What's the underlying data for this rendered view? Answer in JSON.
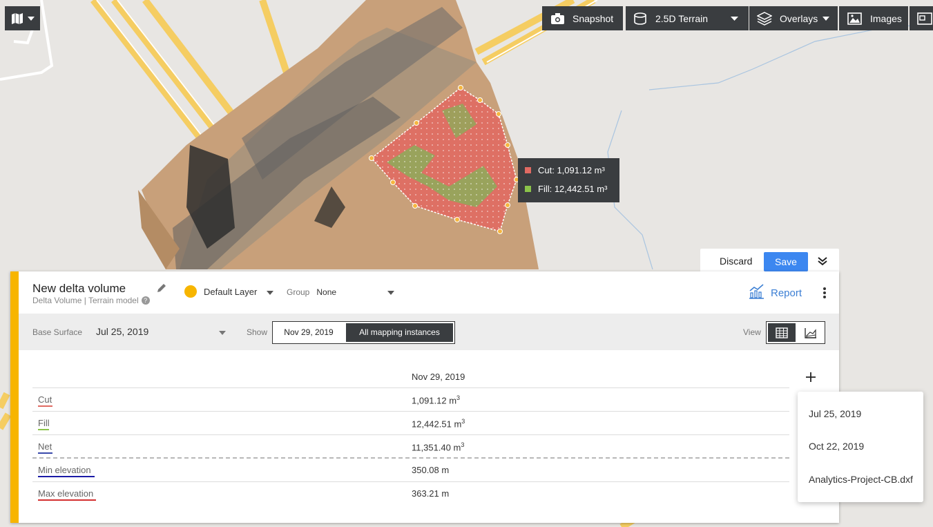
{
  "toolbar": {
    "snapshot_label": "Snapshot",
    "terrain_label": "2.5D Terrain",
    "overlays_label": "Overlays",
    "images_label": "Images"
  },
  "map_tooltip": {
    "cut": "Cut: 1,091.12 m³",
    "fill": "Fill: 12,442.51 m³",
    "cut_color": "#e06a62",
    "fill_color": "#8bc34a"
  },
  "actions": {
    "discard": "Discard",
    "save": "Save"
  },
  "panel": {
    "title": "New delta volume",
    "subtitle": "Delta Volume | Terrain model",
    "layer": "Default Layer",
    "group_label": "Group",
    "group_value": "None",
    "report_label": "Report",
    "accent_color": "#f7b500",
    "base_surface_label": "Base Surface",
    "base_surface_value": "Jul 25, 2019",
    "show_label": "Show",
    "show_date": "Nov 29, 2019",
    "show_all": "All mapping instances",
    "view_label": "View"
  },
  "table": {
    "column_header": "Nov 29, 2019",
    "rows": [
      {
        "label": "Cut",
        "value": "1,091.12 m",
        "sup": "3",
        "color": "#e06a62"
      },
      {
        "label": "Fill",
        "value": "12,442.51 m",
        "sup": "3",
        "color": "#8bc34a"
      },
      {
        "label": "Net",
        "value": "11,351.40 m",
        "sup": "3",
        "color": "#3949ab"
      },
      {
        "label": "Min elevation",
        "value": "350.08 m",
        "sup": "",
        "color": "#1a1aa6"
      },
      {
        "label": "Max elevation",
        "value": "363.21 m",
        "sup": "",
        "color": "#d32f2f"
      }
    ]
  },
  "dropdown": {
    "items": [
      "Jul 25, 2019",
      "Oct 22, 2019",
      "Analytics-Project-CB.dxf"
    ]
  }
}
